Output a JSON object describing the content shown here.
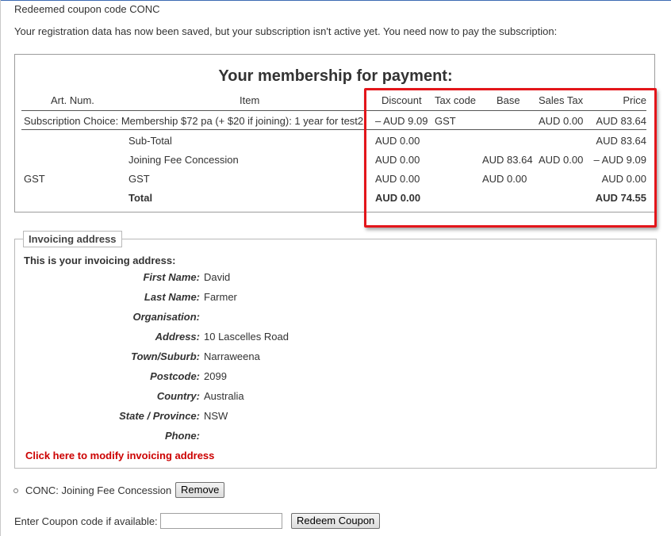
{
  "messages": {
    "redeemed": "Redeemed coupon code CONC",
    "saved": "Your registration data has now been saved, but your subscription isn't active yet. You need now to pay the subscription:"
  },
  "membership": {
    "title": "Your membership for payment:",
    "headers": {
      "art_num": "Art. Num.",
      "item": "Item",
      "discount": "Discount",
      "tax_code": "Tax code",
      "base": "Base",
      "sales_tax": "Sales Tax",
      "price": "Price"
    },
    "subscription_row": {
      "item": "Subscription Choice: Membership $72 pa (+ $20 if joining): 1 year for test2",
      "discount": "– AUD 9.09",
      "tax_code": "GST",
      "sales_tax": "AUD 0.00",
      "price": "AUD 83.64"
    },
    "subtotal_row": {
      "item": "Sub-Total",
      "discount": "AUD 0.00",
      "price": "AUD 83.64"
    },
    "joining_row": {
      "item": "Joining Fee Concession",
      "discount": "AUD 0.00",
      "base": "AUD 83.64",
      "sales_tax": "AUD 0.00",
      "price": "– AUD 9.09"
    },
    "gst_row": {
      "art_num": "GST",
      "item": "GST",
      "discount": "AUD 0.00",
      "base": "AUD 0.00",
      "price": "AUD 0.00"
    },
    "total_row": {
      "item": "Total",
      "discount": "AUD 0.00",
      "price": "AUD 74.55"
    }
  },
  "invoicing": {
    "legend": "Invoicing address",
    "intro": "This is your invoicing address:",
    "fields": [
      {
        "label": "First Name:",
        "value": "David"
      },
      {
        "label": "Last Name:",
        "value": "Farmer"
      },
      {
        "label": "Organisation:",
        "value": ""
      },
      {
        "label": "Address:",
        "value": "10 Lascelles Road"
      },
      {
        "label": "Town/Suburb:",
        "value": "Narraweena"
      },
      {
        "label": "Postcode:",
        "value": "2099"
      },
      {
        "label": "Country:",
        "value": "Australia"
      },
      {
        "label": "State / Province:",
        "value": "NSW"
      },
      {
        "label": "Phone:",
        "value": ""
      }
    ],
    "modify_link": "Click here to modify invoicing address"
  },
  "coupon": {
    "applied": "CONC: Joining Fee Concession",
    "remove_label": "Remove",
    "enter_label": "Enter Coupon code if available:",
    "input_value": "",
    "redeem_label": "Redeem Coupon"
  },
  "colors": {
    "highlight": "#e3151a",
    "link": "#cc0000"
  }
}
